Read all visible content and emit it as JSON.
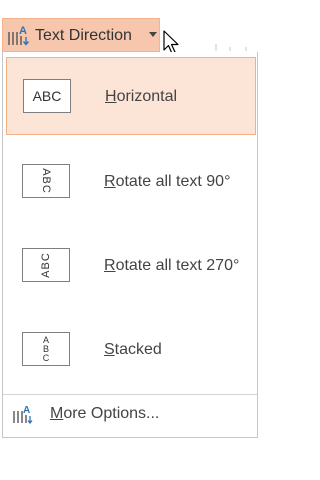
{
  "ribbon_button": {
    "label": "Text Direction",
    "icon": "text-direction-icon",
    "state": "pressed"
  },
  "menu": {
    "items": [
      {
        "accel": "H",
        "rest": "orizontal",
        "thumb_text": "ABC",
        "icon": "horizontal-text-icon",
        "selected": true
      },
      {
        "accel": "R",
        "rest": "otate all text 90°",
        "thumb_text": "ABC",
        "icon": "rotate-90-text-icon",
        "selected": false
      },
      {
        "accel": "R",
        "rest": "otate all text 270°",
        "thumb_text": "ABC",
        "icon": "rotate-270-text-icon",
        "selected": false
      },
      {
        "accel": "S",
        "rest": "tacked",
        "thumb_letters": [
          "A",
          "B",
          "C"
        ],
        "icon": "stacked-text-icon",
        "selected": false
      }
    ],
    "more_options": {
      "accel": "M",
      "rest": "ore Options...",
      "icon": "text-direction-icon"
    }
  },
  "colors": {
    "pressed_fill": "#f6c6ad",
    "selected_fill": "#fce4d6",
    "selected_border": "#f4b183",
    "icon_blue": "#2e75b6"
  }
}
